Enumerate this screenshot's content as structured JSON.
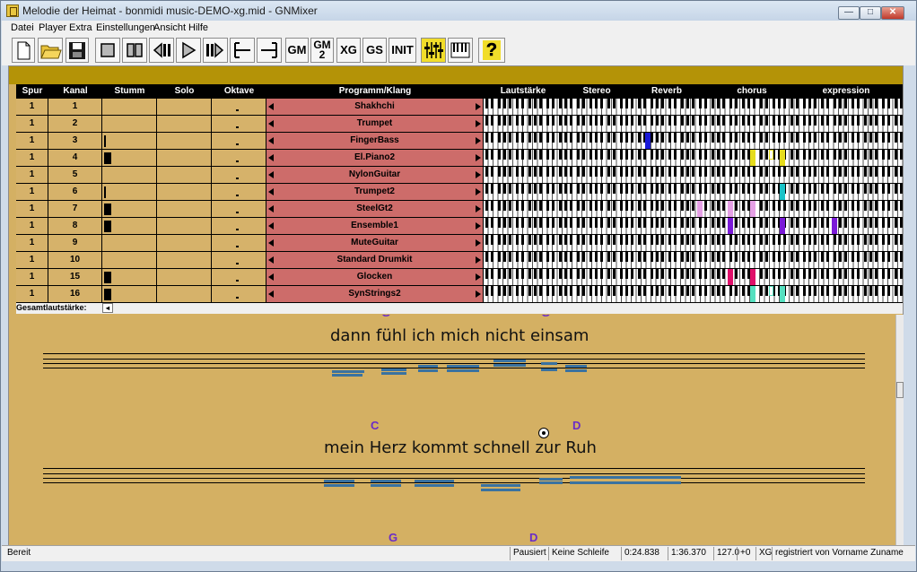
{
  "window": {
    "title": "Melodie der Heimat - bonmidi music-DEMO-xg.mid - GNMixer"
  },
  "menu": [
    "Datei",
    "Player",
    "Extra",
    "Einstellungen",
    "Ansicht",
    "Hilfe"
  ],
  "toolbar": {
    "gm": "GM",
    "gm2_top": "GM",
    "gm2_bottom": "2",
    "xg": "XG",
    "gs": "GS",
    "init": "INIT",
    "help": "?"
  },
  "headers": {
    "spur": "Spur",
    "kanal": "Kanal",
    "stumm": "Stumm",
    "solo": "Solo",
    "oktave": "Oktave",
    "programm": "Programm/Klang",
    "lautstaerke": "Lautstärke",
    "stereo": "Stereo",
    "reverb": "Reverb",
    "chorus": "chorus",
    "expression": "expression"
  },
  "tracks": [
    {
      "spur": "1",
      "kanal": "1",
      "programm": "Shakhchi",
      "stumm": 0
    },
    {
      "spur": "1",
      "kanal": "2",
      "programm": "Trumpet",
      "stumm": 0
    },
    {
      "spur": "1",
      "kanal": "3",
      "programm": "FingerBass",
      "stumm": 0.25
    },
    {
      "spur": "1",
      "kanal": "4",
      "programm": "El.Piano2",
      "stumm": 1
    },
    {
      "spur": "1",
      "kanal": "5",
      "programm": "NylonGuitar",
      "stumm": 0
    },
    {
      "spur": "1",
      "kanal": "6",
      "programm": "Trumpet2",
      "stumm": 0.25
    },
    {
      "spur": "1",
      "kanal": "7",
      "programm": "SteelGt2",
      "stumm": 1
    },
    {
      "spur": "1",
      "kanal": "8",
      "programm": "Ensemble1",
      "stumm": 1
    },
    {
      "spur": "1",
      "kanal": "9",
      "programm": "MuteGuitar",
      "stumm": 0
    },
    {
      "spur": "1",
      "kanal": "10",
      "programm": "Standard Drumkit",
      "stumm": 0
    },
    {
      "spur": "1",
      "kanal": "15",
      "programm": "Glocken",
      "stumm": 1
    },
    {
      "spur": "1",
      "kanal": "16",
      "programm": "SynStrings2",
      "stumm": 1
    }
  ],
  "gesamt_label": "Gesamtlautstärke:",
  "score": {
    "lyrics": [
      "dann fühl ich mich nicht einsam",
      "mein Herz kommt schnell zur Ruh"
    ],
    "chords": [
      "C",
      "D",
      "G",
      "D"
    ]
  },
  "status": {
    "ready": "Bereit",
    "state": "Pausiert",
    "loop": "Keine Schleife",
    "position": "0:24.838",
    "length": "1:36.370",
    "tempo": "127.0",
    "transpose": "+0",
    "mode": "XG",
    "registered": "registriert von Vorname Zuname"
  },
  "colors": {
    "mixer_bg": "#d4b063",
    "top_strip": "#b49307",
    "program_cell": "#cd6c6a",
    "chord": "#6a2bc8",
    "note_bar": "#3a72a0"
  }
}
